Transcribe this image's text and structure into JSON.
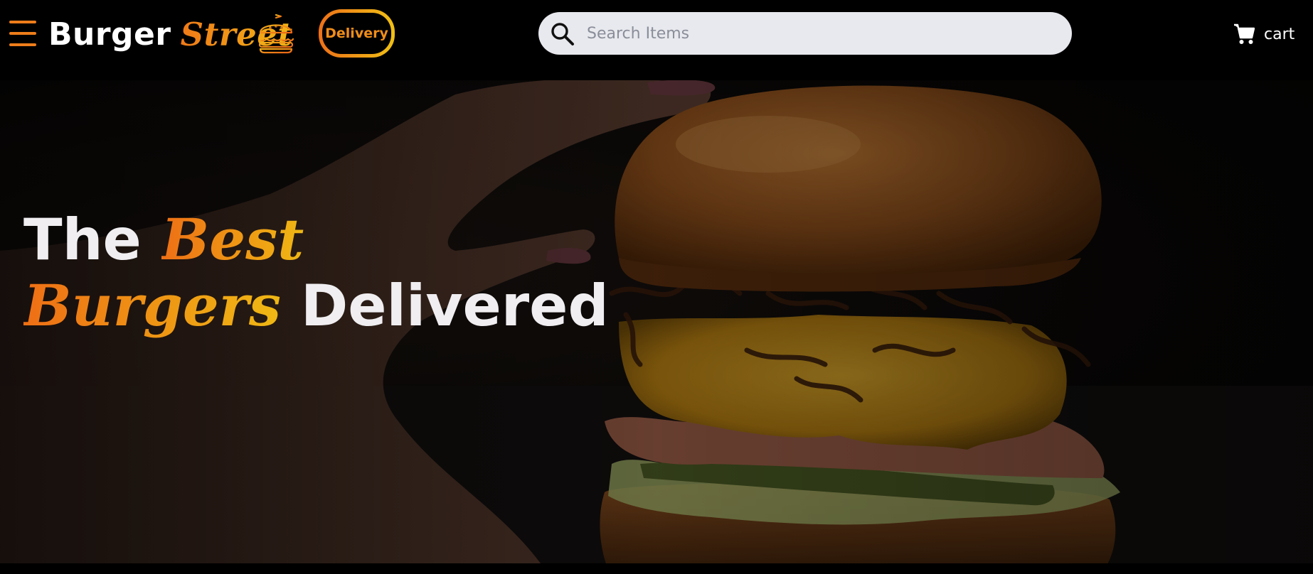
{
  "header": {
    "brand_word1": "Burger",
    "brand_word2": "Street",
    "delivery_label": "Delivery",
    "search_placeholder": "Search Items",
    "cart_label": "cart",
    "icons": {
      "menu": "hamburger-menu-icon",
      "logo": "burger-logo-icon",
      "search": "search-icon",
      "cart": "cart-icon"
    }
  },
  "hero": {
    "line1_plain": "The",
    "line1_accent": "Best",
    "line2_accent": "Burgers",
    "line2_plain": "Delivered",
    "image": "burger-hero-image"
  },
  "colors": {
    "accent_orange": "#ee7a18",
    "accent_yellow": "#f0b814",
    "search_bg": "#e8e9ee",
    "header_bg": "#000000"
  }
}
